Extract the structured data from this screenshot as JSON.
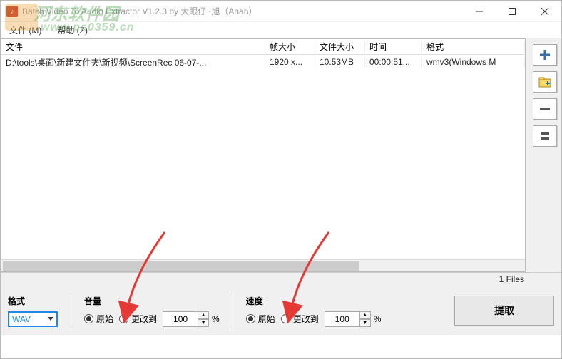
{
  "window": {
    "title": "Batch Video To Audio Extractor V1.2.3 by 大眼仔~旭（Anan）"
  },
  "menu": {
    "file": "文件 (M)",
    "help": "帮助 (Z)"
  },
  "table": {
    "headers": {
      "file": "文件",
      "frame": "帧大小",
      "size": "文件大小",
      "time": "时间",
      "format": "格式"
    },
    "rows": [
      {
        "file": "D:\\tools\\桌面\\新建文件夹\\新视频\\ScreenRec 06-07-...",
        "frame": "1920 x...",
        "size": "10.53MB",
        "time": "00:00:51...",
        "format": "wmv3(Windows M"
      }
    ]
  },
  "status": {
    "files_count": "1 Files"
  },
  "controls": {
    "format_label": "格式",
    "format_value": "WAV",
    "volume_label": "音量",
    "speed_label": "速度",
    "radio_original": "原始",
    "radio_change_to": "更改到",
    "percent_value": "100",
    "percent_sign": "%",
    "extract": "提取"
  },
  "icons": {
    "add": "plus-icon",
    "add_folder": "folder-plus-icon",
    "remove": "minus-icon",
    "clear": "clear-icon"
  },
  "watermark": {
    "line1": "河东软件园",
    "line2": "www.pc0359.cn"
  }
}
